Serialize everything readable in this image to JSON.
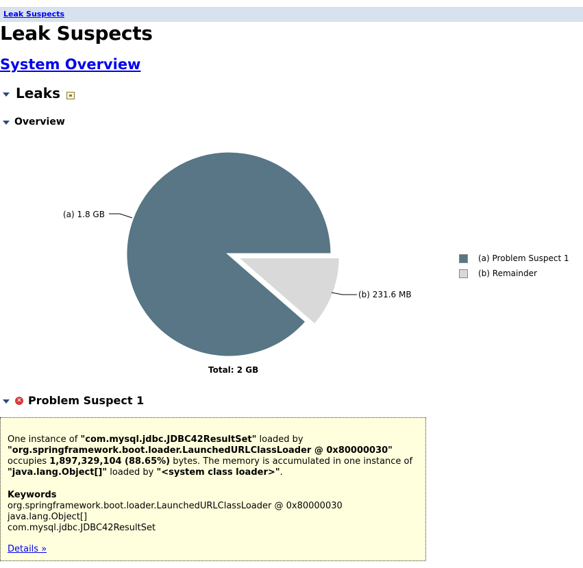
{
  "breadcrumb": {
    "label": "Leak Suspects"
  },
  "page": {
    "title": "Leak Suspects",
    "overview_link": "System Overview"
  },
  "leaks": {
    "heading": "Leaks",
    "overview_heading": "Overview"
  },
  "chart_data": {
    "type": "pie",
    "categories": [
      "(a)  Problem Suspect 1",
      "(b)  Remainder"
    ],
    "values": [
      1.8,
      0.2316
    ],
    "units": "GB",
    "slice_labels": [
      "(a)  1.8 GB",
      "(b)  231.6 MB"
    ],
    "colors": [
      "#587685",
      "#d9d9d9"
    ],
    "total_label": "Total: 2 GB",
    "exploded": [
      false,
      true
    ],
    "legend_placement": "right"
  },
  "suspect": {
    "heading": "Problem Suspect 1",
    "status_icon": "error-icon",
    "line1_a": "One instance of ",
    "line1_class": "\"com.mysql.jdbc.JDBC42ResultSet\"",
    "line1_b": " loaded by",
    "line2_loader": "\"org.springframework.boot.loader.LaunchedURLClassLoader @ 0x80000030\"",
    "line3_a": "occupies ",
    "line3_bytes": "1,897,329,104 (88.65%)",
    "line3_b": " bytes. The memory is accumulated in one instance of",
    "line4_class": "\"java.lang.Object[]\"",
    "line4_a": " loaded by ",
    "line4_loader": "\"<system class loader>\"",
    "line4_b": ".",
    "keywords_title": "Keywords",
    "keywords": [
      "org.springframework.boot.loader.LaunchedURLClassLoader @ 0x80000030",
      "java.lang.Object[]",
      "com.mysql.jdbc.JDBC42ResultSet"
    ],
    "details_link": "Details »"
  }
}
